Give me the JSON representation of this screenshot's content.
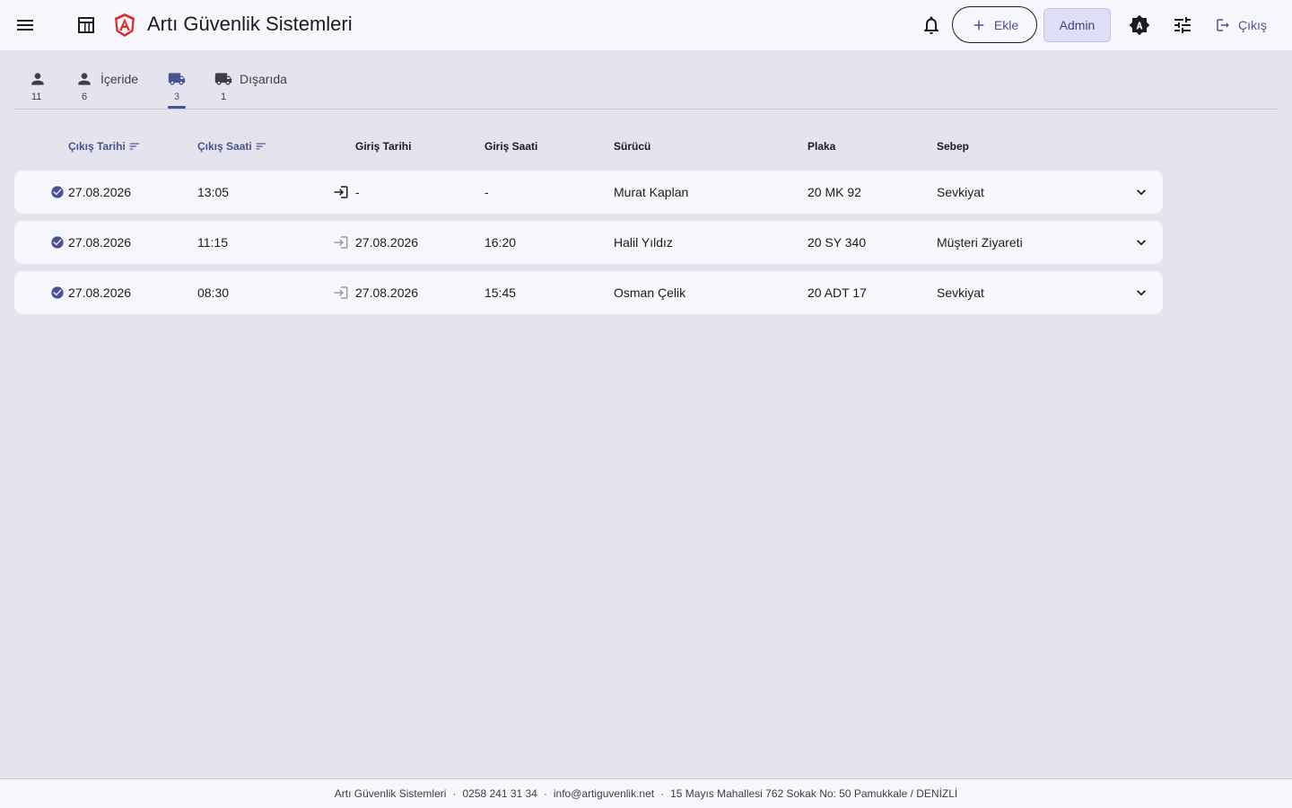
{
  "header": {
    "app_title": "Artı Güvenlik Sistemleri",
    "add_label": "Ekle",
    "admin_label": "Admin",
    "logout_label": "Çıkış",
    "icons": [
      "menu-icon",
      "dashboard-icon",
      "logo-icon",
      "bell-icon",
      "plus-icon",
      "theme-icon",
      "tune-icon",
      "logout-icon"
    ]
  },
  "tabs": [
    {
      "label": "",
      "count": "11",
      "icon": "person-icon"
    },
    {
      "label": "İçeride",
      "count": "6",
      "icon": "person-icon"
    },
    {
      "label": "",
      "count": "3",
      "icon": "truck-icon",
      "active": true
    },
    {
      "label": "Dışarıda",
      "count": "1",
      "icon": "truck-icon"
    }
  ],
  "table": {
    "columns": [
      "Çıkış Tarihi",
      "Çıkış Saati",
      "Giriş Tarihi",
      "Giriş Saati",
      "Sürücü",
      "Plaka",
      "Sebep"
    ],
    "rows": [
      {
        "exit_date": "27.08.2026",
        "exit_time": "13:05",
        "entry_date": "-",
        "entry_time": "-",
        "driver": "Murat Kaplan",
        "plate": "20 MK 92",
        "reason": "Sevkiyat"
      },
      {
        "exit_date": "27.08.2026",
        "exit_time": "11:15",
        "entry_date": "27.08.2026",
        "entry_time": "16:20",
        "driver": "Halil Yıldız",
        "plate": "20 SY 340",
        "reason": "Müşteri Ziyareti"
      },
      {
        "exit_date": "27.08.2026",
        "exit_time": "08:30",
        "entry_date": "27.08.2026",
        "entry_time": "15:45",
        "driver": "Osman Çelik",
        "plate": "20 ADT 17",
        "reason": "Sevkiyat"
      }
    ]
  },
  "footer": {
    "company": "Artı Güvenlik Sistemleri",
    "phone": "0258 241 31 34",
    "email": "info@artiguvenlik.net",
    "address": "15 Mayıs Mahallesi 762 Sokak No: 50 Pamukkale / DENİZLİ",
    "separator": "·"
  },
  "colors": {
    "accent": "#4a5290",
    "surface": "#f7f6fc",
    "background": "#e4e3ee",
    "logo_red": "#dd2c2c"
  }
}
